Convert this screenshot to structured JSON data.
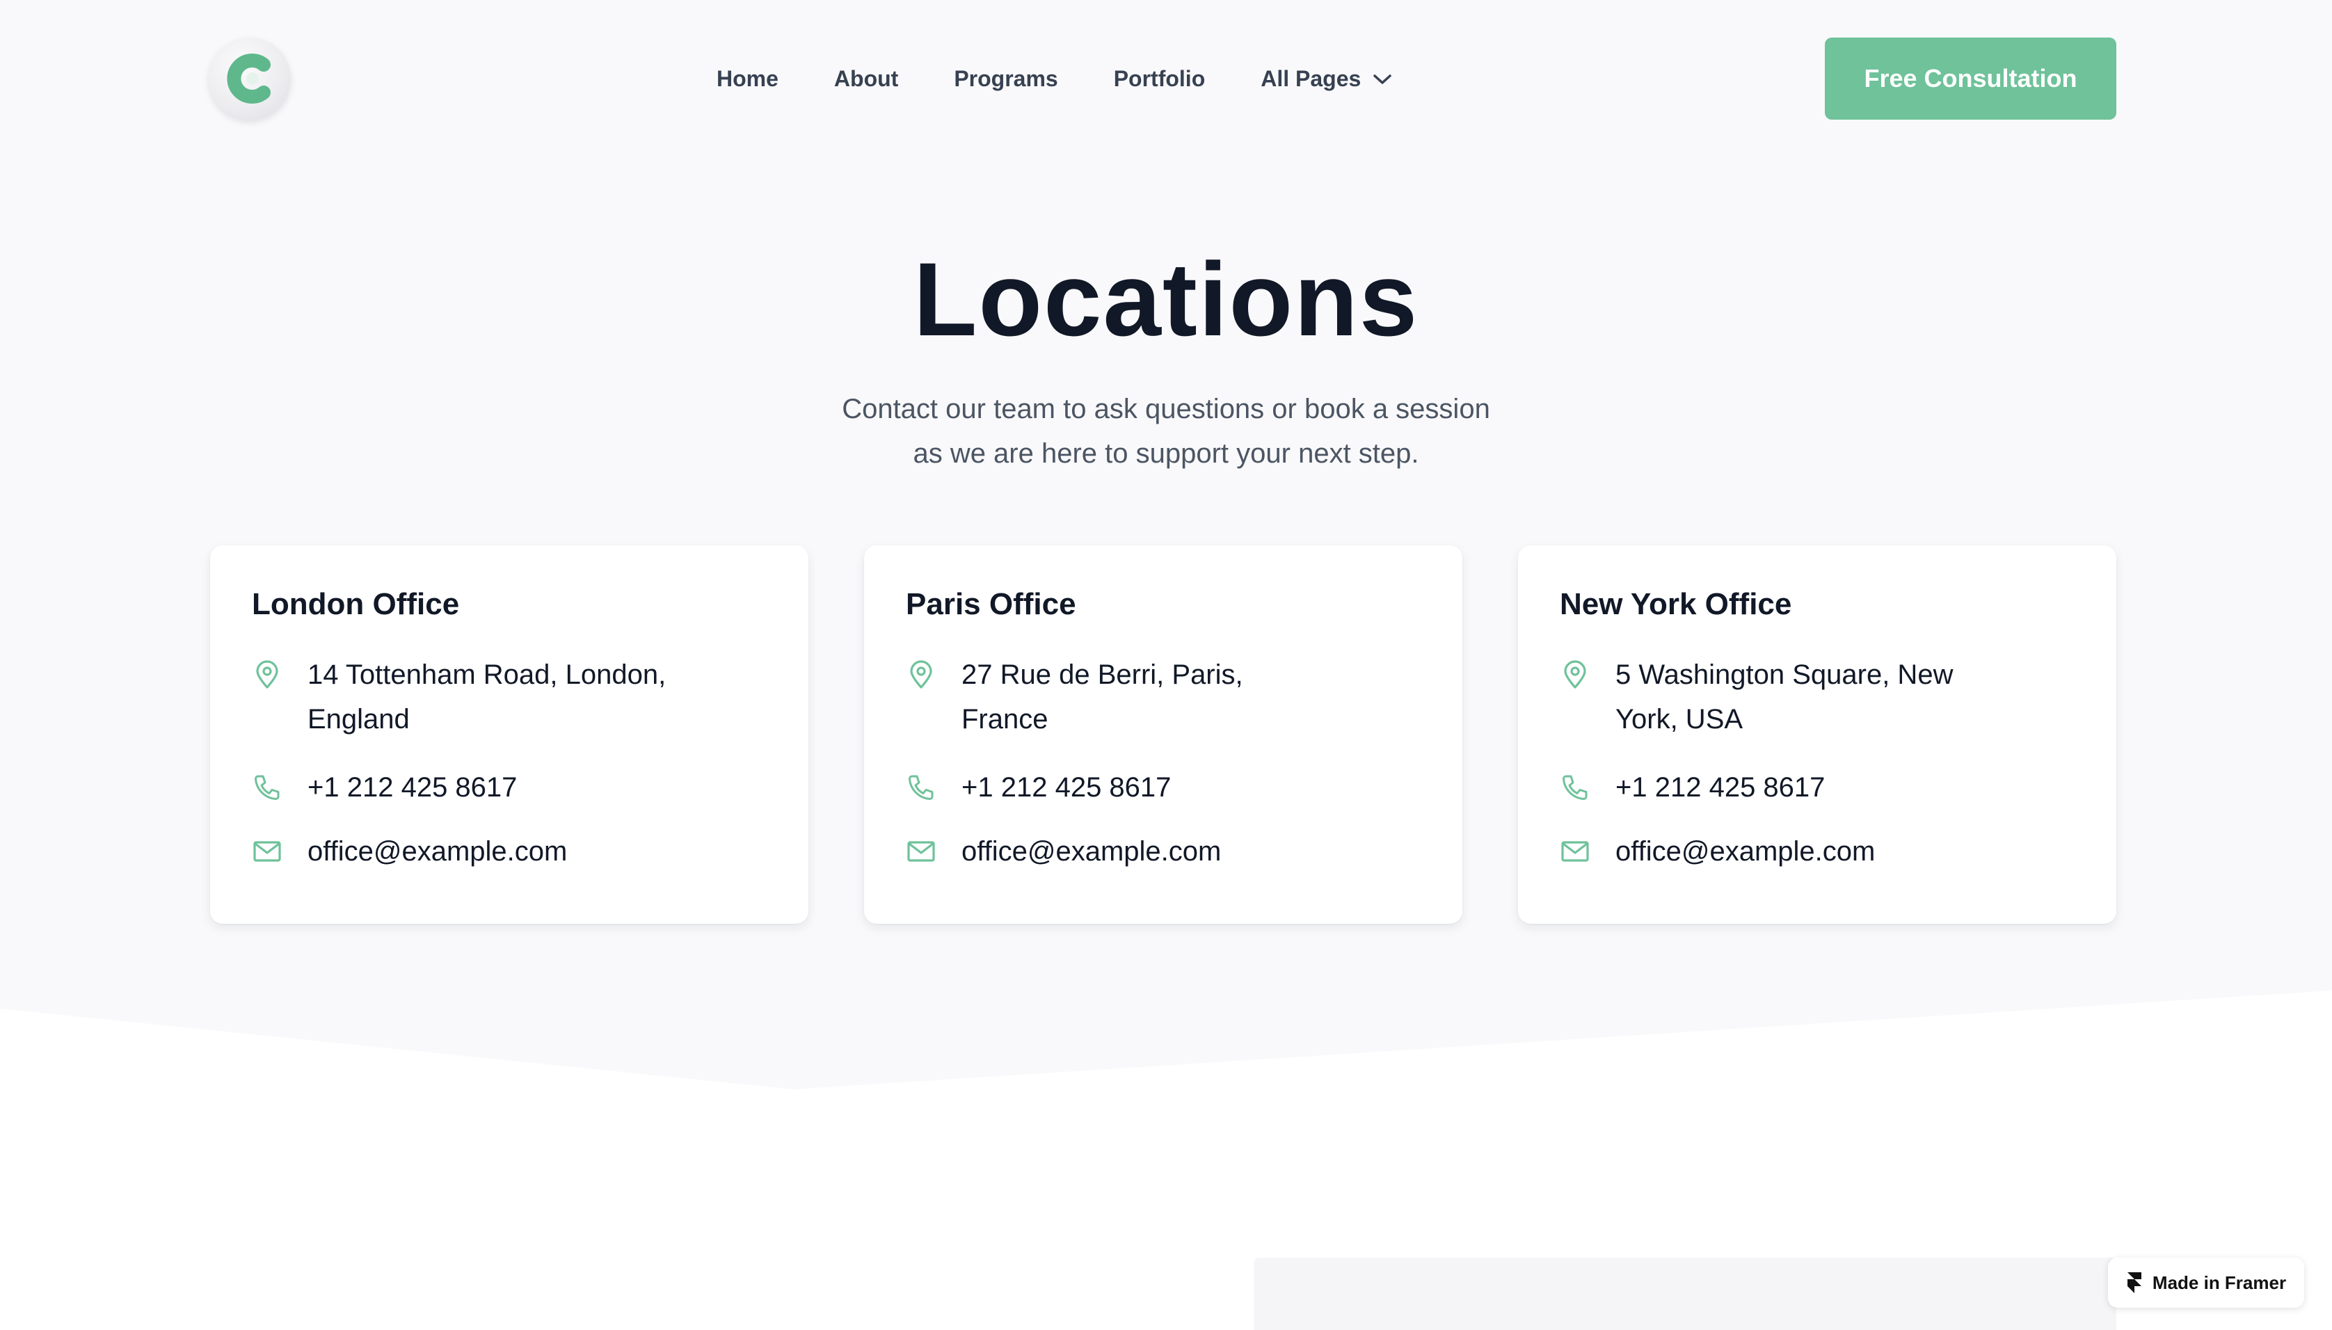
{
  "header": {
    "logo_letter": "C",
    "nav": [
      "Home",
      "About",
      "Programs",
      "Portfolio",
      "All Pages"
    ],
    "cta_label": "Free Consultation"
  },
  "hero": {
    "title": "Locations",
    "subtitle_line1": "Contact our team to ask questions or book a session",
    "subtitle_line2": "as we are here to support your next step."
  },
  "offices": [
    {
      "name": "London Office",
      "address_line1": "14 Tottenham Road, London,",
      "address_line2": "England",
      "phone": "+1 212 425 8617",
      "email": "office@example.com"
    },
    {
      "name": "Paris Office",
      "address_line1": "27 Rue de Berri, Paris,",
      "address_line2": "France",
      "phone": "+1 212 425 8617",
      "email": "office@example.com"
    },
    {
      "name": "New York Office",
      "address_line1": "5 Washington Square, New",
      "address_line2": "York, USA",
      "phone": "+1 212 425 8617",
      "email": "office@example.com"
    }
  ],
  "badge": {
    "label": "Made in Framer"
  },
  "colors": {
    "accent": "#6fc29a",
    "background": "#f9f9fb",
    "heading": "#111827",
    "muted": "#4b5563"
  },
  "icons": {
    "address": "map-pin-icon",
    "phone": "phone-icon",
    "email": "mail-icon",
    "dropdown": "chevron-down-icon",
    "badge": "framer-logo-icon"
  }
}
